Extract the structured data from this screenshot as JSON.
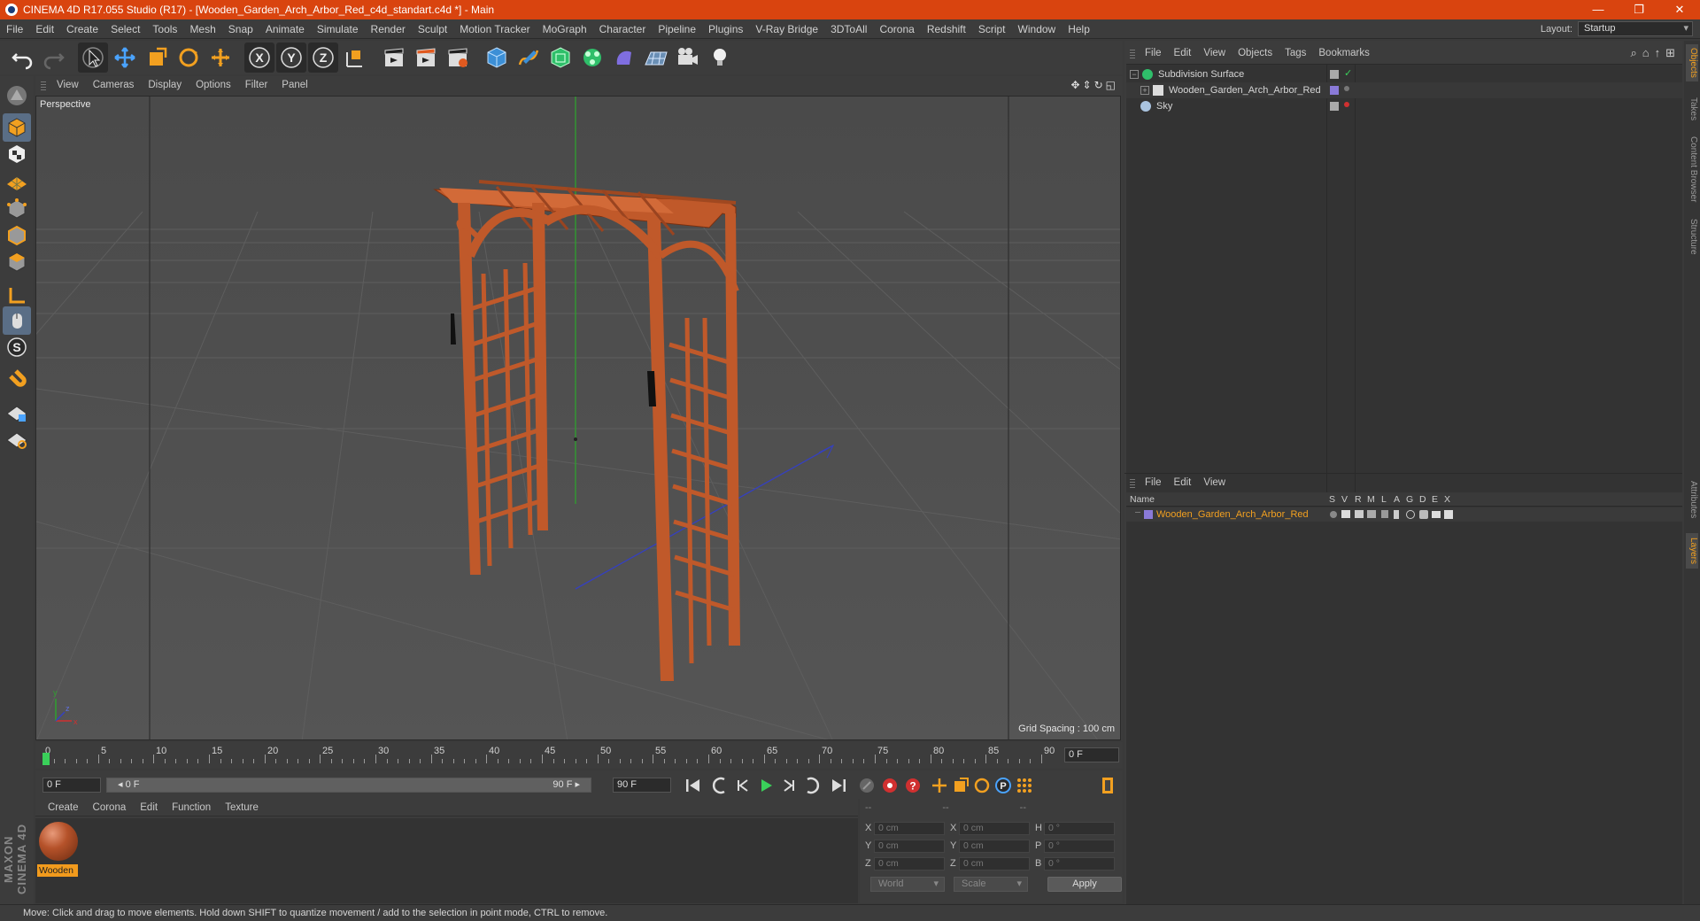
{
  "window": {
    "title": "CINEMA 4D R17.055 Studio (R17) - [Wooden_Garden_Arch_Arbor_Red_c4d_standart.c4d *] - Main",
    "controls": [
      "—",
      "❐",
      "✕"
    ]
  },
  "menubar": {
    "items": [
      "File",
      "Edit",
      "Create",
      "Select",
      "Tools",
      "Mesh",
      "Snap",
      "Animate",
      "Simulate",
      "Render",
      "Sculpt",
      "Motion Tracker",
      "MoGraph",
      "Character",
      "Pipeline",
      "Plugins",
      "V-Ray Bridge",
      "3DToAll",
      "Corona",
      "Redshift",
      "Script",
      "Window",
      "Help"
    ],
    "layout_label": "Layout:",
    "layout_value": "Startup"
  },
  "viewport": {
    "menu": [
      "View",
      "Cameras",
      "Display",
      "Options",
      "Filter",
      "Panel"
    ],
    "label": "Perspective",
    "grid_spacing": "Grid Spacing : 100 cm"
  },
  "timeline": {
    "ticks": [
      "0",
      "5",
      "10",
      "15",
      "20",
      "25",
      "30",
      "35",
      "40",
      "45",
      "50",
      "55",
      "60",
      "65",
      "70",
      "75",
      "80",
      "85",
      "90"
    ],
    "current_frame": "0 F"
  },
  "transport": {
    "start_field": "0 F",
    "slider_start": "◂ 0 F",
    "slider_end": "90 F ▸",
    "end_field": "90 F"
  },
  "material_manager": {
    "menu": [
      "Create",
      "Corona",
      "Edit",
      "Function",
      "Texture"
    ],
    "materials": [
      {
        "name": "Wooden"
      }
    ]
  },
  "coordinates": {
    "header": [
      "--",
      "--",
      "--"
    ],
    "rows": [
      {
        "a": "X",
        "av": "0 cm",
        "b": "X",
        "bv": "0 cm",
        "c": "H",
        "cv": "0 °"
      },
      {
        "a": "Y",
        "av": "0 cm",
        "b": "Y",
        "bv": "0 cm",
        "c": "P",
        "cv": "0 °"
      },
      {
        "a": "Z",
        "av": "0 cm",
        "b": "Z",
        "bv": "0 cm",
        "c": "B",
        "cv": "0 °"
      }
    ],
    "mode": "World",
    "scale": "Scale",
    "apply": "Apply"
  },
  "object_manager": {
    "menu": [
      "File",
      "Edit",
      "View",
      "Objects",
      "Tags",
      "Bookmarks"
    ],
    "objects": [
      {
        "name": "Subdivision Surface"
      },
      {
        "name": "Wooden_Garden_Arch_Arbor_Red"
      },
      {
        "name": "Sky"
      }
    ]
  },
  "layer_manager": {
    "menu": [
      "File",
      "Edit",
      "View"
    ],
    "columns": [
      "Name",
      "S",
      "V",
      "R",
      "M",
      "L",
      "A",
      "G",
      "D",
      "E",
      "X"
    ],
    "layers": [
      {
        "name": "Wooden_Garden_Arch_Arbor_Red",
        "color": "#8a7ad8"
      }
    ]
  },
  "side_tabs": [
    "Objects",
    "Takes",
    "Content Browser",
    "Structure",
    "Attributes",
    "Layers"
  ],
  "status": "Move: Click and drag to move elements. Hold down SHIFT to quantize movement / add to the selection in point mode, CTRL to remove.",
  "brand": "MAXON CINEMA 4D",
  "colors": {
    "accent": "#d9440f",
    "selection": "#f2a020",
    "wood": "#c0592a"
  }
}
